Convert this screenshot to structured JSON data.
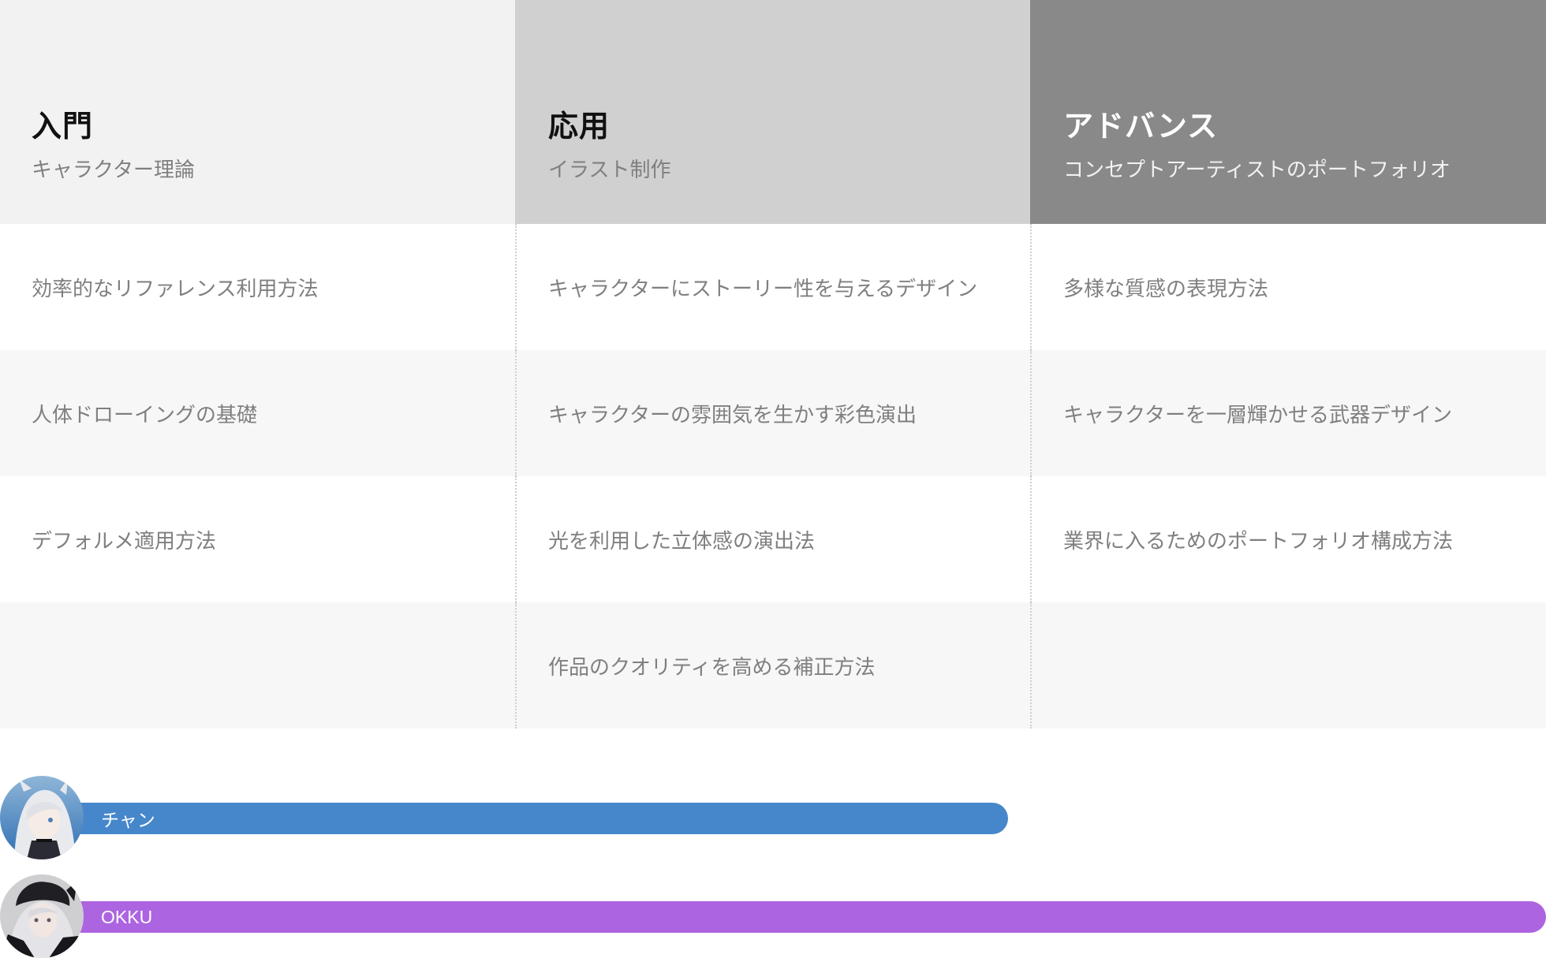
{
  "columns": [
    {
      "title": "入門",
      "subtitle": "キャラクター理論",
      "items": [
        "効率的なリファレンス利用方法",
        "人体ドローイングの基礎",
        "デフォルメ適用方法",
        ""
      ]
    },
    {
      "title": "応用",
      "subtitle": "イラスト制作",
      "items": [
        "キャラクターにストーリー性を与えるデザイン",
        "キャラクターの雰囲気を生かす彩色演出",
        "光を利用した立体感の演出法",
        "作品のクオリティを高める補正方法"
      ]
    },
    {
      "title": "アドバンス",
      "subtitle": "コンセプトアーティストのポートフォリオ",
      "items": [
        "多様な質感の表現方法",
        "キャラクターを一層輝かせる武器デザイン",
        "業界に入るためのポートフォリオ構成方法",
        ""
      ]
    }
  ],
  "learners": [
    {
      "name": "チャン",
      "progress": 0.637,
      "color": "#4687cb"
    },
    {
      "name": "OKKU",
      "progress": 1.0,
      "color": "#ad64e0"
    }
  ],
  "colors": {
    "head_1": "#f2f2f2",
    "head_2": "#d0d0d0",
    "head_3": "#898989",
    "row_alt": "#f7f7f7"
  }
}
